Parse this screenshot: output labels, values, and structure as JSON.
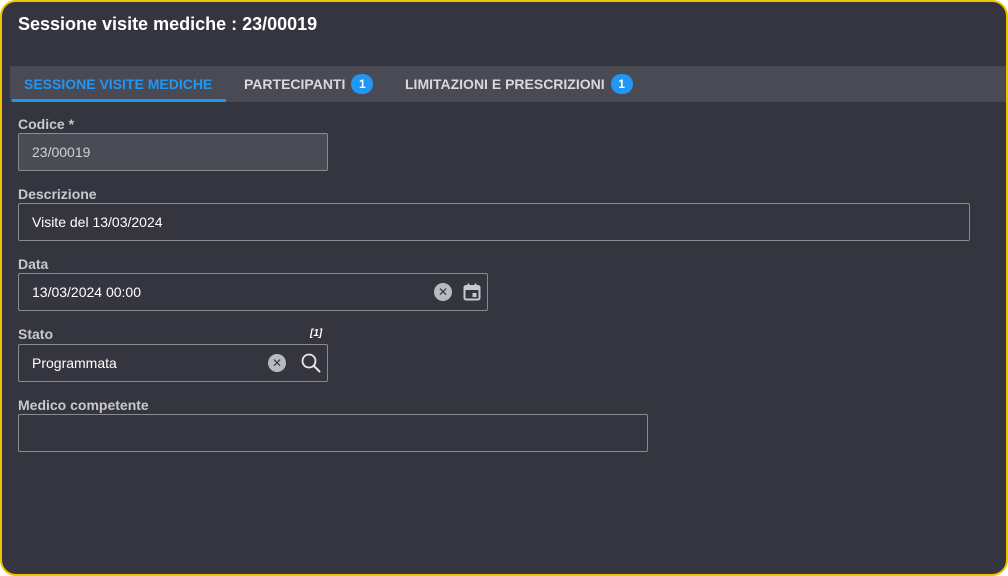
{
  "window": {
    "title": "Sessione visite mediche : 23/00019"
  },
  "tabs": [
    {
      "label": "SESSIONE VISITE MEDICHE",
      "badge": ""
    },
    {
      "label": "PARTECIPANTI",
      "badge": "1"
    },
    {
      "label": "LIMITAZIONI E PRESCRIZIONI",
      "badge": "1"
    }
  ],
  "form": {
    "codice": {
      "label": "Codice *",
      "value": "23/00019"
    },
    "descrizione": {
      "label": "Descrizione",
      "value": "Visite del 13/03/2024"
    },
    "data": {
      "label": "Data",
      "value": "13/03/2024 00:00"
    },
    "stato": {
      "label": "Stato",
      "value": "Programmata",
      "ref": "[1]"
    },
    "medico": {
      "label": "Medico competente",
      "value": ""
    }
  },
  "icons": {
    "clear": "clear-icon",
    "calendar": "calendar-icon",
    "search": "search-icon"
  },
  "colors": {
    "background": "#353540",
    "accent": "#2196f3",
    "frame": "#f2c200"
  }
}
